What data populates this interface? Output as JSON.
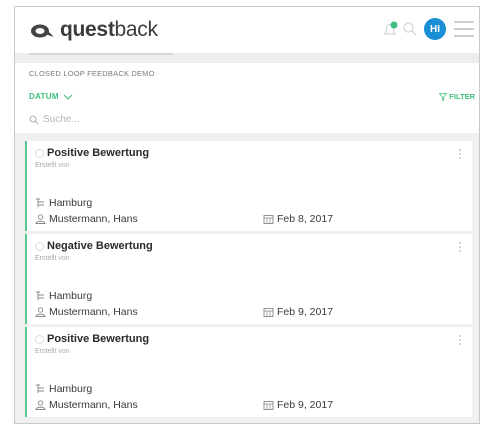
{
  "header": {
    "logo_bold": "quest",
    "logo_light": "back",
    "avatar_initials": "HI",
    "accent_color": "#3fbf7f",
    "avatar_color": "#1a8fd6"
  },
  "toolbar": {
    "subtitle": "CLOSED LOOP FEEDBACK DEMO",
    "sort_label": "DATUM",
    "filter_label": "FILTER"
  },
  "search": {
    "placeholder": "Suche..."
  },
  "cards": [
    {
      "title": "Positive Bewertung",
      "subtitle": "Erstellt von",
      "location": "Hamburg",
      "person": "Mustermann, Hans",
      "date": "Feb 8, 2017"
    },
    {
      "title": "Negative Bewertung",
      "subtitle": "Erstellt von",
      "location": "Hamburg",
      "person": "Mustermann, Hans",
      "date": "Feb 9, 2017"
    },
    {
      "title": "Positive Bewertung",
      "subtitle": "Erstellt von",
      "location": "Hamburg",
      "person": "Mustermann, Hans",
      "date": "Feb 9, 2017"
    }
  ]
}
